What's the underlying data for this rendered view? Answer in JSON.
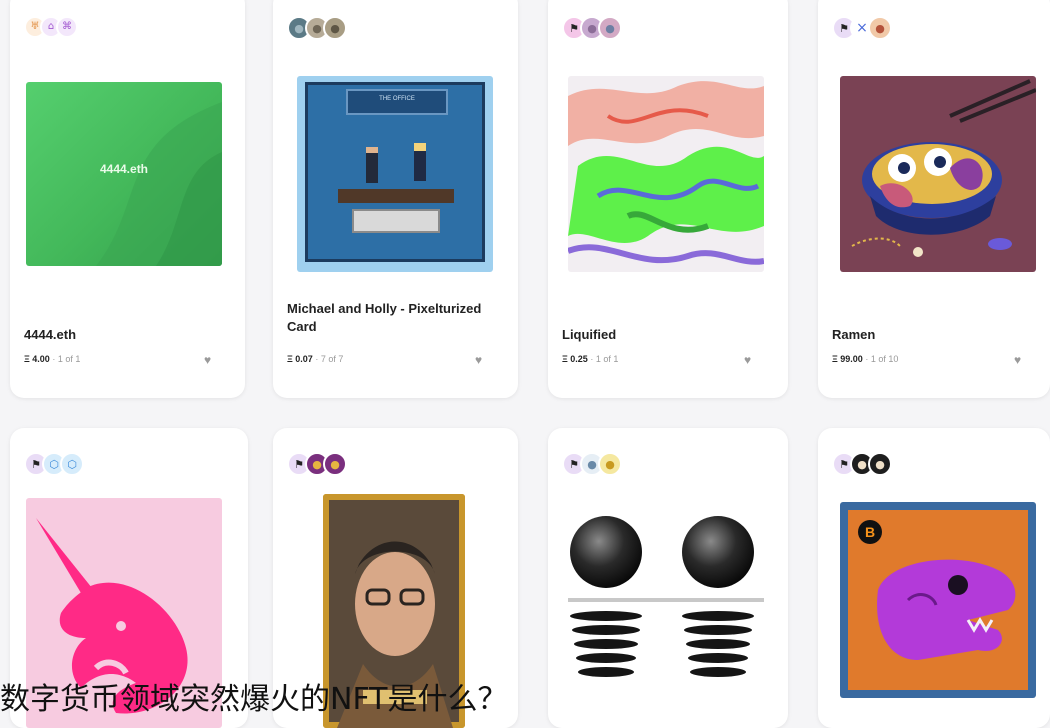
{
  "cards": [
    {
      "title": "4444.eth",
      "art_text": "4444.eth",
      "price": "Ξ 4.00",
      "edition": "1 of 1",
      "avatars": [
        {
          "icon": "tent-icon",
          "glyph": "♅"
        },
        {
          "icon": "house-icon",
          "glyph": "⌂"
        },
        {
          "icon": "bank-icon",
          "glyph": "⌘"
        }
      ]
    },
    {
      "title": "Michael and Holly - Pixelturized Card",
      "art_text": "THE OFFICE",
      "price": "Ξ 0.07",
      "edition": "7 of 7",
      "avatars": [
        {
          "icon": "avatar-icon",
          "glyph": "●"
        },
        {
          "icon": "avatar-icon",
          "glyph": "●"
        },
        {
          "icon": "avatar-icon",
          "glyph": "●"
        }
      ]
    },
    {
      "title": "Liquified",
      "price": "Ξ 0.25",
      "edition": "1 of 1",
      "avatars": [
        {
          "icon": "flag-icon",
          "glyph": "⚑"
        },
        {
          "icon": "avatar-icon",
          "glyph": "●"
        },
        {
          "icon": "avatar-icon",
          "glyph": "●"
        }
      ]
    },
    {
      "title": "Ramen",
      "price": "Ξ 99.00",
      "edition": "1 of 10",
      "avatars": [
        {
          "icon": "flag-icon",
          "glyph": "⚑"
        },
        {
          "icon": "close-icon",
          "glyph": "×"
        },
        {
          "icon": "avatar-icon",
          "glyph": "●"
        }
      ]
    },
    {
      "avatars": [
        {
          "icon": "flag-icon",
          "glyph": "⚑"
        },
        {
          "icon": "hexagon-icon",
          "glyph": "⬡"
        },
        {
          "icon": "hexagon-icon",
          "glyph": "⬡"
        }
      ]
    },
    {
      "avatars": [
        {
          "icon": "flag-icon",
          "glyph": "⚑"
        },
        {
          "icon": "avatar-icon",
          "glyph": "●"
        },
        {
          "icon": "avatar-icon",
          "glyph": "●"
        }
      ]
    },
    {
      "avatars": [
        {
          "icon": "flag-icon",
          "glyph": "⚑"
        },
        {
          "icon": "avatar-icon",
          "glyph": "●"
        },
        {
          "icon": "avatar-icon",
          "glyph": "●"
        }
      ]
    },
    {
      "bitcoin_glyph": "B",
      "avatars": [
        {
          "icon": "flag-icon",
          "glyph": "⚑"
        },
        {
          "icon": "avatar-icon",
          "glyph": "●"
        },
        {
          "icon": "avatar-icon",
          "glyph": "●"
        }
      ]
    }
  ],
  "heart_glyph": "♥",
  "caption": "数字货币领域突然爆火的NFT是什么？",
  "colors": {
    "background": "#f5f5f7",
    "heart": "#9a9a9a",
    "green_art": "#4cc765",
    "ramen_bg": "#7a4254",
    "unicorn": "#ff2a86",
    "dino_bg": "#e07a2c"
  }
}
